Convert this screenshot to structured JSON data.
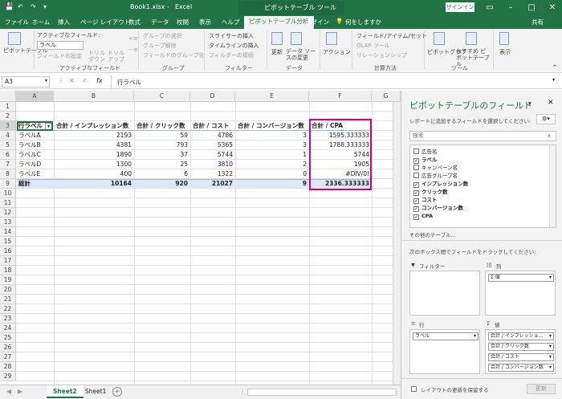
{
  "app": {
    "filename": "Book1.xlsx",
    "app_name": "Excel",
    "context_tool": "ピボットテーブル ツール",
    "signin": "サインイン",
    "share": "共有"
  },
  "tabs": [
    "ファイル",
    "ホーム",
    "挿入",
    "ページ レイアウト",
    "数式",
    "データ",
    "校閲",
    "表示",
    "ヘルプ",
    "ピボットテーブル分析",
    "デザイン",
    "何をしますか"
  ],
  "ribbon": {
    "pivot_table": "ピボットテーブル",
    "active_field_label": "アクティブなフィールド:",
    "active_field_value": "ラベル",
    "field_settings": "フィールドの設定",
    "drilldown": "ドリル ダウン",
    "drillup": "ドリル アップ",
    "group_active_field": "アクティブなフィールド",
    "group_selection": "グループの選択",
    "ungroup": "グループ解除",
    "group_field": "フィールドのグループ化",
    "group_group": "グループ",
    "slicer": "スライサーの挿入",
    "timeline": "タイムラインの挿入",
    "filter_conn": "フィルターの接続",
    "group_filter": "フィルター",
    "refresh": "更新",
    "change_source": "データ ソースの変更",
    "group_data": "データ",
    "actions": "アクション",
    "fields_items_sets": "フィールド/アイテム/セット",
    "olap": "OLAP ツール",
    "relationships": "リレーションシップ",
    "group_calc": "計算方法",
    "pivot_chart": "ピボットグラフ",
    "recommended": "おすすめ ピボットテーブル",
    "group_tools": "ツール",
    "show": "表示"
  },
  "formula_bar": {
    "name_box": "A3",
    "fx": "fx",
    "content": "行ラベル"
  },
  "columns": [
    "A",
    "B",
    "C",
    "D",
    "E",
    "F",
    "G"
  ],
  "rows": [
    "1",
    "2",
    "3",
    "4",
    "5",
    "6",
    "7",
    "8",
    "9",
    "10",
    "11",
    "12",
    "13",
    "14",
    "15",
    "16",
    "17",
    "18",
    "19",
    "20",
    "21",
    "22",
    "23",
    "24",
    "25",
    "26",
    "27",
    "28",
    "29"
  ],
  "pivot": {
    "headers": [
      "行ラベル",
      "合計 / インプレッション数",
      "合計 / クリック数",
      "合計 / コスト",
      "合計 / コンバージョン数",
      "合計 / CPA"
    ],
    "data": [
      [
        "ラベルA",
        "2193",
        "59",
        "4786",
        "3",
        "1595.333333"
      ],
      [
        "ラベルB",
        "4381",
        "793",
        "5365",
        "3",
        "1788.333333"
      ],
      [
        "ラベルC",
        "1890",
        "37",
        "5744",
        "1",
        "5744"
      ],
      [
        "ラベルD",
        "1300",
        "25",
        "3810",
        "2",
        "1905"
      ],
      [
        "ラベルE",
        "400",
        "6",
        "1322",
        "0",
        "#DIV/0!"
      ]
    ],
    "total": [
      "総計",
      "10164",
      "920",
      "21027",
      "9",
      "2336.333333"
    ]
  },
  "sheets": [
    "Sheet2",
    "Sheet1"
  ],
  "pane": {
    "title": "ピボットテーブルのフィールド",
    "subtitle": "レポートに追加するフィールドを選択してください:",
    "search_placeholder": "検索",
    "fields": [
      {
        "name": "広告名",
        "checked": false
      },
      {
        "name": "ラベル",
        "checked": true
      },
      {
        "name": "キャンペーン名",
        "checked": false
      },
      {
        "name": "広告グループ名",
        "checked": false
      },
      {
        "name": "インプレッション数",
        "checked": true
      },
      {
        "name": "クリック数",
        "checked": true
      },
      {
        "name": "コスト",
        "checked": true
      },
      {
        "name": "コンバージョン数",
        "checked": true
      },
      {
        "name": "CPA",
        "checked": true
      }
    ],
    "other_tables": "その他のテーブル...",
    "drag_hint": "次のボックス間でフィールドをドラッグしてください:",
    "filter_label": "フィルター",
    "columns_label": "列",
    "rows_label": "行",
    "values_label": "値",
    "columns_chip": "Σ 値",
    "rows_chip": "ラベル",
    "values_chips": [
      "合計 / インプレッショ...",
      "合計 / クリック数",
      "合計 / コスト",
      "合計 / コンバージョン数"
    ],
    "defer": "レイアウトの更新を保留する",
    "update": "更新"
  }
}
